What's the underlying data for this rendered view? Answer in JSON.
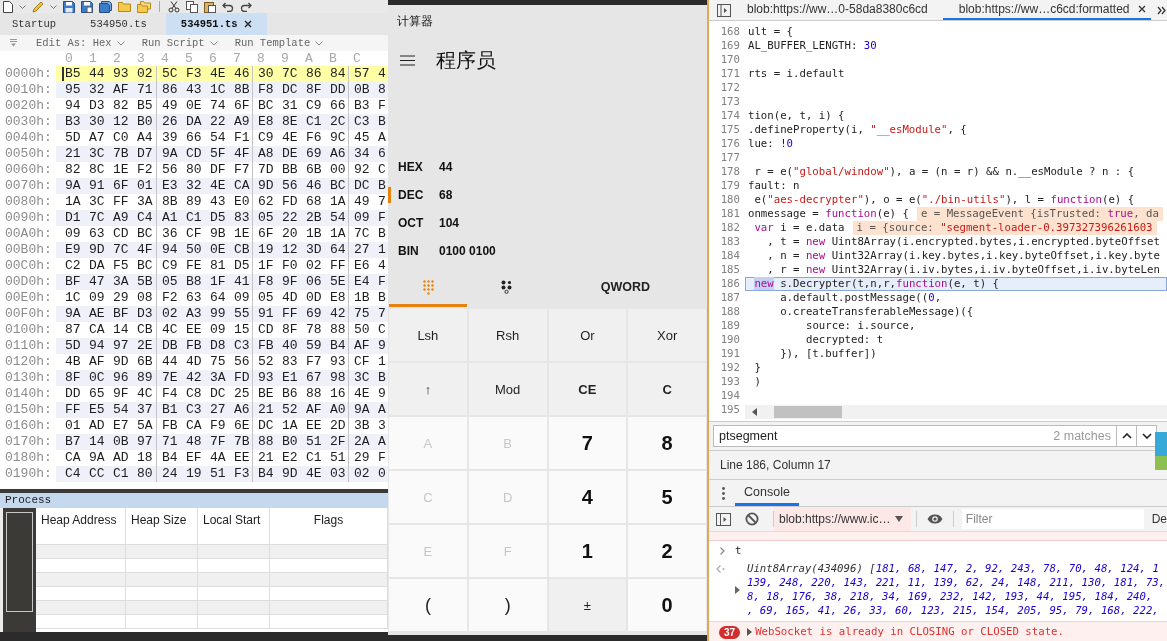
{
  "hex_editor": {
    "tabs": [
      {
        "label": "Startup",
        "selected": false
      },
      {
        "label": "534950.ts",
        "selected": false
      },
      {
        "label": "534951.ts",
        "selected": true
      }
    ],
    "options": [
      "Edit As: Hex",
      "Run Script",
      "Run Template"
    ],
    "column_headers": [
      "0",
      "1",
      "2",
      "3",
      "4",
      "5",
      "6",
      "7",
      "8",
      "9",
      "A",
      "B",
      "C"
    ],
    "rows": [
      {
        "offset": "0000h:",
        "selected": true,
        "bytes": [
          "B5",
          "44",
          "93",
          "02",
          "5C",
          "F3",
          "4E",
          "46",
          "30",
          "7C",
          "86",
          "84",
          "57",
          "4"
        ]
      },
      {
        "offset": "0010h:",
        "selected": false,
        "bytes": [
          "95",
          "32",
          "AF",
          "71",
          "86",
          "43",
          "1C",
          "8B",
          "F8",
          "DC",
          "8F",
          "DD",
          "0B",
          "8"
        ]
      },
      {
        "offset": "0020h:",
        "selected": false,
        "bytes": [
          "94",
          "D3",
          "82",
          "B5",
          "49",
          "0E",
          "74",
          "6F",
          "BC",
          "31",
          "C9",
          "66",
          "B3",
          "F"
        ]
      },
      {
        "offset": "0030h:",
        "selected": false,
        "bytes": [
          "B3",
          "30",
          "12",
          "B0",
          "26",
          "DA",
          "22",
          "A9",
          "E8",
          "8E",
          "C1",
          "2C",
          "C3",
          "B"
        ]
      },
      {
        "offset": "0040h:",
        "selected": false,
        "bytes": [
          "5D",
          "A7",
          "C0",
          "A4",
          "39",
          "66",
          "54",
          "F1",
          "C9",
          "4E",
          "F6",
          "9C",
          "45",
          "A"
        ]
      },
      {
        "offset": "0050h:",
        "selected": false,
        "bytes": [
          "21",
          "3C",
          "7B",
          "D7",
          "9A",
          "CD",
          "5F",
          "4F",
          "A8",
          "DE",
          "69",
          "A6",
          "34",
          "6"
        ]
      },
      {
        "offset": "0060h:",
        "selected": false,
        "bytes": [
          "82",
          "8C",
          "1E",
          "F2",
          "56",
          "80",
          "DF",
          "F7",
          "7D",
          "BB",
          "6B",
          "00",
          "92",
          "C"
        ]
      },
      {
        "offset": "0070h:",
        "selected": false,
        "bytes": [
          "9A",
          "91",
          "6F",
          "01",
          "E3",
          "32",
          "4E",
          "CA",
          "9D",
          "56",
          "46",
          "BC",
          "DC",
          "B"
        ]
      },
      {
        "offset": "0080h:",
        "selected": false,
        "bytes": [
          "1A",
          "3C",
          "FF",
          "3A",
          "8B",
          "89",
          "43",
          "E0",
          "62",
          "FD",
          "68",
          "1A",
          "49",
          "7"
        ]
      },
      {
        "offset": "0090h:",
        "selected": false,
        "bytes": [
          "D1",
          "7C",
          "A9",
          "C4",
          "A1",
          "C1",
          "D5",
          "83",
          "05",
          "22",
          "2B",
          "54",
          "09",
          "F"
        ]
      },
      {
        "offset": "00A0h:",
        "selected": false,
        "bytes": [
          "09",
          "63",
          "CD",
          "BC",
          "36",
          "CF",
          "9B",
          "1E",
          "6F",
          "20",
          "1B",
          "1A",
          "7C",
          "B"
        ]
      },
      {
        "offset": "00B0h:",
        "selected": false,
        "bytes": [
          "E9",
          "9D",
          "7C",
          "4F",
          "94",
          "50",
          "0E",
          "CB",
          "19",
          "12",
          "3D",
          "64",
          "27",
          "1"
        ]
      },
      {
        "offset": "00C0h:",
        "selected": false,
        "bytes": [
          "C2",
          "DA",
          "F5",
          "BC",
          "C9",
          "FE",
          "81",
          "D5",
          "1F",
          "F0",
          "02",
          "FF",
          "E6",
          "4"
        ]
      },
      {
        "offset": "00D0h:",
        "selected": false,
        "bytes": [
          "BF",
          "47",
          "3A",
          "5B",
          "05",
          "B8",
          "1F",
          "41",
          "F8",
          "9F",
          "06",
          "5E",
          "E4",
          "F"
        ]
      },
      {
        "offset": "00E0h:",
        "selected": false,
        "bytes": [
          "1C",
          "09",
          "29",
          "08",
          "F2",
          "63",
          "64",
          "09",
          "05",
          "4D",
          "0D",
          "E8",
          "1B",
          "B"
        ]
      },
      {
        "offset": "00F0h:",
        "selected": false,
        "bytes": [
          "9A",
          "AE",
          "BF",
          "D3",
          "02",
          "A3",
          "99",
          "55",
          "91",
          "FF",
          "69",
          "42",
          "75",
          "7"
        ]
      },
      {
        "offset": "0100h:",
        "selected": false,
        "bytes": [
          "87",
          "CA",
          "14",
          "CB",
          "4C",
          "EE",
          "09",
          "15",
          "CD",
          "8F",
          "78",
          "88",
          "50",
          "C"
        ]
      },
      {
        "offset": "0110h:",
        "selected": false,
        "bytes": [
          "5D",
          "94",
          "97",
          "2E",
          "DB",
          "FB",
          "D8",
          "C3",
          "FB",
          "40",
          "59",
          "B4",
          "AF",
          "9"
        ]
      },
      {
        "offset": "0120h:",
        "selected": false,
        "bytes": [
          "4B",
          "AF",
          "9D",
          "6B",
          "44",
          "4D",
          "75",
          "56",
          "52",
          "83",
          "F7",
          "93",
          "CF",
          "1"
        ]
      },
      {
        "offset": "0130h:",
        "selected": false,
        "bytes": [
          "8F",
          "0C",
          "96",
          "89",
          "7E",
          "42",
          "3A",
          "FD",
          "93",
          "E1",
          "67",
          "98",
          "3C",
          "B"
        ]
      },
      {
        "offset": "0140h:",
        "selected": false,
        "bytes": [
          "DD",
          "65",
          "9F",
          "4C",
          "F4",
          "C8",
          "DC",
          "25",
          "BE",
          "B6",
          "88",
          "16",
          "4E",
          "9"
        ]
      },
      {
        "offset": "0150h:",
        "selected": false,
        "bytes": [
          "FF",
          "E5",
          "54",
          "37",
          "B1",
          "C3",
          "27",
          "A6",
          "21",
          "52",
          "AF",
          "A0",
          "9A",
          "A"
        ]
      },
      {
        "offset": "0160h:",
        "selected": false,
        "bytes": [
          "01",
          "AD",
          "E7",
          "5A",
          "FB",
          "CA",
          "F9",
          "6E",
          "DC",
          "1A",
          "EE",
          "2D",
          "3B",
          "3"
        ]
      },
      {
        "offset": "0170h:",
        "selected": false,
        "bytes": [
          "B7",
          "14",
          "0B",
          "97",
          "71",
          "48",
          "7F",
          "7B",
          "88",
          "B0",
          "51",
          "2F",
          "2A",
          "A"
        ]
      },
      {
        "offset": "0180h:",
        "selected": false,
        "bytes": [
          "CA",
          "9A",
          "AD",
          "18",
          "B4",
          "EF",
          "4A",
          "EE",
          "21",
          "E2",
          "C1",
          "51",
          "29",
          "F"
        ]
      },
      {
        "offset": "0190h:",
        "selected": false,
        "bytes": [
          "C4",
          "CC",
          "C1",
          "80",
          "24",
          "19",
          "51",
          "F3",
          "B4",
          "9D",
          "4E",
          "03",
          "02",
          "0"
        ]
      }
    ]
  },
  "process_panel": {
    "title": "Process",
    "columns": [
      "Heap Address",
      "Heap Size",
      "Local Start",
      "Flags"
    ]
  },
  "calculator": {
    "title": "计算器",
    "mode": "程序员",
    "radix": [
      {
        "label": "HEX",
        "value": "44",
        "selected": false
      },
      {
        "label": "DEC",
        "value": "68",
        "selected": true
      },
      {
        "label": "OCT",
        "value": "104",
        "selected": false
      },
      {
        "label": "BIN",
        "value": "0100 0100",
        "selected": false
      }
    ],
    "tabs": [
      {
        "kind": "keypad",
        "selected": true
      },
      {
        "kind": "bits",
        "selected": false
      },
      {
        "kind": "word",
        "label": "QWORD",
        "selected": false
      }
    ],
    "keys": [
      {
        "label": "Lsh",
        "kind": "function",
        "disabled": false
      },
      {
        "label": "Rsh",
        "kind": "function",
        "disabled": false
      },
      {
        "label": "Or",
        "kind": "function",
        "disabled": false
      },
      {
        "label": "Xor",
        "kind": "function",
        "disabled": false
      },
      {
        "label": "↑",
        "kind": "function",
        "disabled": false
      },
      {
        "label": "Mod",
        "kind": "function",
        "disabled": false
      },
      {
        "label": "CE",
        "kind": "clear",
        "disabled": false
      },
      {
        "label": "C",
        "kind": "clear",
        "disabled": false
      },
      {
        "label": "A",
        "kind": "digit",
        "disabled": true
      },
      {
        "label": "B",
        "kind": "digit",
        "disabled": true
      },
      {
        "label": "7",
        "kind": "digit",
        "disabled": false
      },
      {
        "label": "8",
        "kind": "digit",
        "disabled": false
      },
      {
        "label": "C",
        "kind": "digit",
        "disabled": true
      },
      {
        "label": "D",
        "kind": "digit",
        "disabled": true
      },
      {
        "label": "4",
        "kind": "digit",
        "disabled": false
      },
      {
        "label": "5",
        "kind": "digit",
        "disabled": false
      },
      {
        "label": "E",
        "kind": "digit",
        "disabled": true
      },
      {
        "label": "F",
        "kind": "digit",
        "disabled": true
      },
      {
        "label": "1",
        "kind": "digit",
        "disabled": false
      },
      {
        "label": "2",
        "kind": "digit",
        "disabled": false
      },
      {
        "label": "(",
        "kind": "symbol",
        "disabled": false
      },
      {
        "label": ")",
        "kind": "symbol",
        "disabled": false
      },
      {
        "label": "±",
        "kind": "function",
        "disabled": false
      },
      {
        "label": "0",
        "kind": "digit",
        "disabled": false
      }
    ]
  },
  "devtools": {
    "tabs": [
      {
        "label": "blob:https://ww…0-58da8380c6cd",
        "selected": false
      },
      {
        "label": "blob:https://ww…c6cd:formatted",
        "selected": true
      }
    ],
    "code": {
      "lines": [
        {
          "number": "168",
          "current": false,
          "tokens": [
            {
              "text": "ult = {",
              "kind": "plain"
            }
          ]
        },
        {
          "number": "169",
          "current": false,
          "tokens": [
            {
              "text": "AL_BUFFER_LENGTH: ",
              "kind": "plain"
            },
            {
              "text": "30",
              "kind": "number"
            }
          ]
        },
        {
          "number": "170",
          "current": false
        },
        {
          "number": "171",
          "current": false,
          "tokens": [
            {
              "text": "rts = i.default",
              "kind": "plain"
            }
          ]
        },
        {
          "number": "172",
          "current": false
        },
        {
          "number": "173",
          "current": false
        },
        {
          "number": "174",
          "current": false,
          "tokens": [
            {
              "text": "tion(e, t, i) {",
              "kind": "plain"
            }
          ]
        },
        {
          "number": "175",
          "current": false,
          "tokens": [
            {
              "text": ".defineProperty(i, ",
              "kind": "plain"
            },
            {
              "text": "\"__esModule\"",
              "kind": "string"
            },
            {
              "text": ", {",
              "kind": "plain"
            }
          ]
        },
        {
          "number": "176",
          "current": false,
          "tokens": [
            {
              "text": "lue: ",
              "kind": "plain"
            },
            {
              "text": "!0",
              "kind": "number"
            }
          ]
        },
        {
          "number": "177",
          "current": false
        },
        {
          "number": "178",
          "current": false,
          "tokens": [
            {
              "text": " r = e(",
              "kind": "plain"
            },
            {
              "text": "\"global/window\"",
              "kind": "string"
            },
            {
              "text": "), a = (n = r) && n.__esModule ? n : {",
              "kind": "plain"
            }
          ]
        },
        {
          "number": "179",
          "current": false,
          "tokens": [
            {
              "text": "fault: n",
              "kind": "plain"
            }
          ]
        },
        {
          "number": "180",
          "current": false,
          "tokens": [
            {
              "text": " e(",
              "kind": "plain"
            },
            {
              "text": "\"aes-decrypter\"",
              "kind": "string"
            },
            {
              "text": "), o = e(",
              "kind": "plain"
            },
            {
              "text": "\"./bin-utils\"",
              "kind": "string"
            },
            {
              "text": "), l = ",
              "kind": "plain"
            },
            {
              "text": "function",
              "kind": "keyword"
            },
            {
              "text": "(e) {",
              "kind": "plain"
            }
          ]
        },
        {
          "number": "181",
          "current": false,
          "tokens": [
            {
              "text": "onmessage = ",
              "kind": "plain"
            },
            {
              "text": "function",
              "kind": "keyword"
            },
            {
              "text": "(e) {",
              "kind": "plain"
            }
          ],
          "inline_value": [
            {
              "text": "e = MessageEvent {isTrusted: ",
              "kind": "plain"
            },
            {
              "text": "true",
              "kind": "keyword"
            },
            {
              "text": ", da",
              "kind": "plain"
            }
          ]
        },
        {
          "number": "182",
          "current": false,
          "tokens": [
            {
              "text": " var",
              "kind": "keyword"
            },
            {
              "text": " i = e.data",
              "kind": "plain"
            }
          ],
          "inline_value": [
            {
              "text": "i = {source: ",
              "kind": "plain"
            },
            {
              "text": "\"segment-loader-0.397327396261603",
              "kind": "string"
            }
          ]
        },
        {
          "number": "183",
          "current": false,
          "tokens": [
            {
              "text": "   , t = ",
              "kind": "plain"
            },
            {
              "text": "new",
              "kind": "keyword"
            },
            {
              "text": " Uint8Array(i.encrypted.bytes,i.encrypted.byteOffset",
              "kind": "plain"
            }
          ]
        },
        {
          "number": "184",
          "current": false,
          "tokens": [
            {
              "text": "   , n = ",
              "kind": "plain"
            },
            {
              "text": "new",
              "kind": "keyword"
            },
            {
              "text": " Uint32Array(i.key.bytes,i.key.byteOffset,i.key.byte",
              "kind": "plain"
            }
          ]
        },
        {
          "number": "185",
          "current": false,
          "tokens": [
            {
              "text": "   , r = ",
              "kind": "plain"
            },
            {
              "text": "new",
              "kind": "keyword"
            },
            {
              "text": " Uint32Array(i.iv.bytes,i.iv.byteOffset,i.iv.byteLen",
              "kind": "plain"
            }
          ]
        },
        {
          "number": "186",
          "current": true,
          "tokens": [
            {
              "text": " new",
              "kind": "match"
            },
            {
              "text": " s.Decrypter(t,n,r,",
              "kind": "plain"
            },
            {
              "text": "function",
              "kind": "keyword"
            },
            {
              "text": "(e, t) {",
              "kind": "plain"
            }
          ]
        },
        {
          "number": "187",
          "current": false,
          "tokens": [
            {
              "text": "     a.default.postMessage((",
              "kind": "plain"
            },
            {
              "text": "0",
              "kind": "number"
            },
            {
              "text": ",",
              "kind": "plain"
            }
          ]
        },
        {
          "number": "188",
          "current": false,
          "tokens": [
            {
              "text": "     o.createTransferableMessage)({",
              "kind": "plain"
            }
          ]
        },
        {
          "number": "189",
          "current": false,
          "tokens": [
            {
              "text": "         source: i.source,",
              "kind": "plain"
            }
          ]
        },
        {
          "number": "190",
          "current": false,
          "tokens": [
            {
              "text": "         decrypted: t",
              "kind": "plain"
            }
          ]
        },
        {
          "number": "191",
          "current": false,
          "tokens": [
            {
              "text": "     }), [t.buffer])",
              "kind": "plain"
            }
          ]
        },
        {
          "number": "192",
          "current": false,
          "tokens": [
            {
              "text": " }",
              "kind": "plain"
            }
          ]
        },
        {
          "number": "193",
          "current": false,
          "tokens": [
            {
              "text": " )",
              "kind": "plain"
            }
          ]
        },
        {
          "number": "194",
          "current": false
        },
        {
          "number": "195",
          "current": false
        }
      ]
    },
    "search": {
      "value": "ptsegment",
      "matches": "2 matches"
    },
    "status": "Line 186, Column 17",
    "drawer_tabs": [
      {
        "label": "Console",
        "selected": true
      }
    ],
    "console": {
      "context": "blob:https://www.ic…",
      "filter": {
        "placeholder": "Filter"
      },
      "levels": "De",
      "messages": [
        {
          "kind": "error-partial"
        },
        {
          "kind": "input",
          "text": "t"
        },
        {
          "kind": "result",
          "lines": [
            {
              "tokens": [
                {
                  "text": "Uint8Array(434096) [",
                  "kind": "plain"
                },
                {
                  "text": "181, 68, 147, 2, 92, 243, 78, 70, 48, 124, 1",
                  "kind": "number"
                }
              ]
            },
            {
              "tokens": [
                {
                  "text": "139, 248, 220, 143, 221, 11, 139, 62, 24, 148, 211, 130, 181, 73,",
                  "kind": "number"
                }
              ]
            },
            {
              "tokens": [
                {
                  "text": "8, 18, 176, 38, 218, 34, 169, 232, 142, 193, 44, 195, 184, 240,",
                  "kind": "number"
                }
              ]
            },
            {
              "tokens": [
                {
                  "text": ", 69, 165, 41, 26, 33, 60, 123, 215, 154, 205, 95, 79, 168, 222,",
                  "kind": "number"
                }
              ]
            }
          ]
        },
        {
          "kind": "error",
          "count": "37",
          "text": "WebSocket is already in CLOSING or CLOSED state."
        }
      ]
    }
  }
}
